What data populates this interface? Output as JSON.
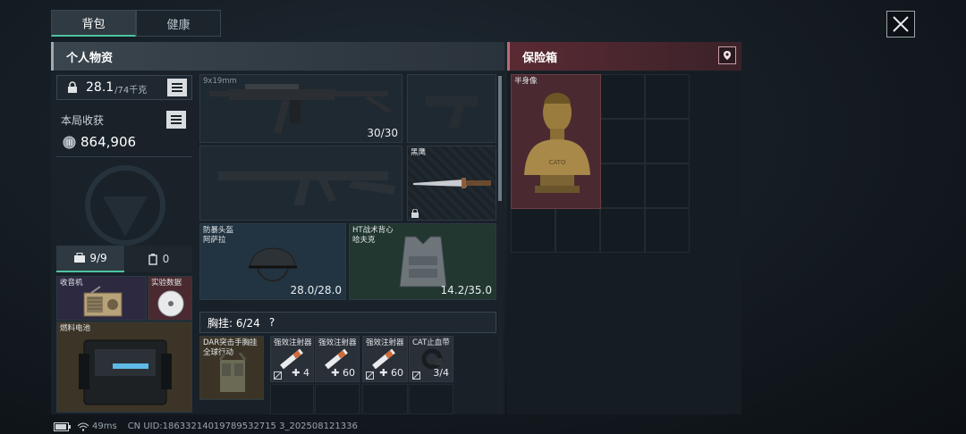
{
  "tabs": [
    {
      "label": "背包"
    },
    {
      "label": "健康"
    }
  ],
  "personal": {
    "title": "个人物资",
    "weight_value": "28.1",
    "weight_max": "/74千克",
    "haul_label": "本局收获",
    "haul_value": "864,906",
    "bag_counts": {
      "tools": "9/9",
      "cases": "0"
    }
  },
  "safe_box": {
    "title": "保险箱",
    "item_label": "半身像",
    "statue_text": "CATO"
  },
  "weapons": {
    "primary_ammo": "30/30",
    "primary_caliber": "9x19mm",
    "knife_label": "黑鹰"
  },
  "armor": {
    "helmet_label": "防暴头盔\n阿萨拉",
    "helmet_durability": "28.0/28.0",
    "vest_label": "HT战术背心\n哈夫克",
    "vest_durability": "14.2/35.0"
  },
  "chest_rig": {
    "title": "胸挂: 6/24",
    "help": "?",
    "rig_label": "DAR突击手胸挂\n全球行动",
    "items": [
      {
        "label": "强效注射器",
        "count": "4"
      },
      {
        "label": "强效注射器",
        "count": "60"
      },
      {
        "label": "强效注射器",
        "count": "60"
      },
      {
        "label": "CAT止血带",
        "count": "3/4"
      }
    ]
  },
  "left_items": [
    {
      "label": "收音机"
    },
    {
      "label": "实验数据"
    },
    {
      "label": "燃料电池"
    }
  ],
  "status": {
    "ping": "49ms",
    "uid": "CN UID:18633214019789532715 3_202508121336"
  }
}
